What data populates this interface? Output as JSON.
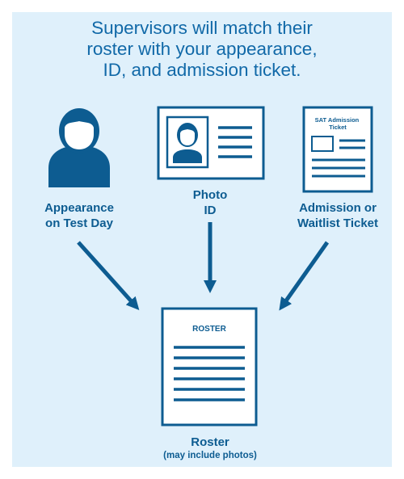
{
  "headline": "Supervisors will match their\nroster with your appearance,\nID, and admission ticket.",
  "items": {
    "appearance": {
      "label": "Appearance\non Test Day",
      "icon": "person-silhouette-icon"
    },
    "photo_id": {
      "label": "Photo\nID",
      "icon": "photo-id-card-icon"
    },
    "ticket": {
      "label": "Admission or\nWaitlist Ticket",
      "card_title": "SAT Admission\nTicket",
      "icon": "admission-ticket-icon"
    },
    "roster": {
      "label": "Roster",
      "sublabel": "(may include photos)",
      "card_title": "ROSTER",
      "icon": "roster-document-icon"
    }
  },
  "colors": {
    "background": "#dff0fb",
    "primary": "#0d5c91",
    "headline": "#1169a8",
    "card": "#ffffff"
  }
}
